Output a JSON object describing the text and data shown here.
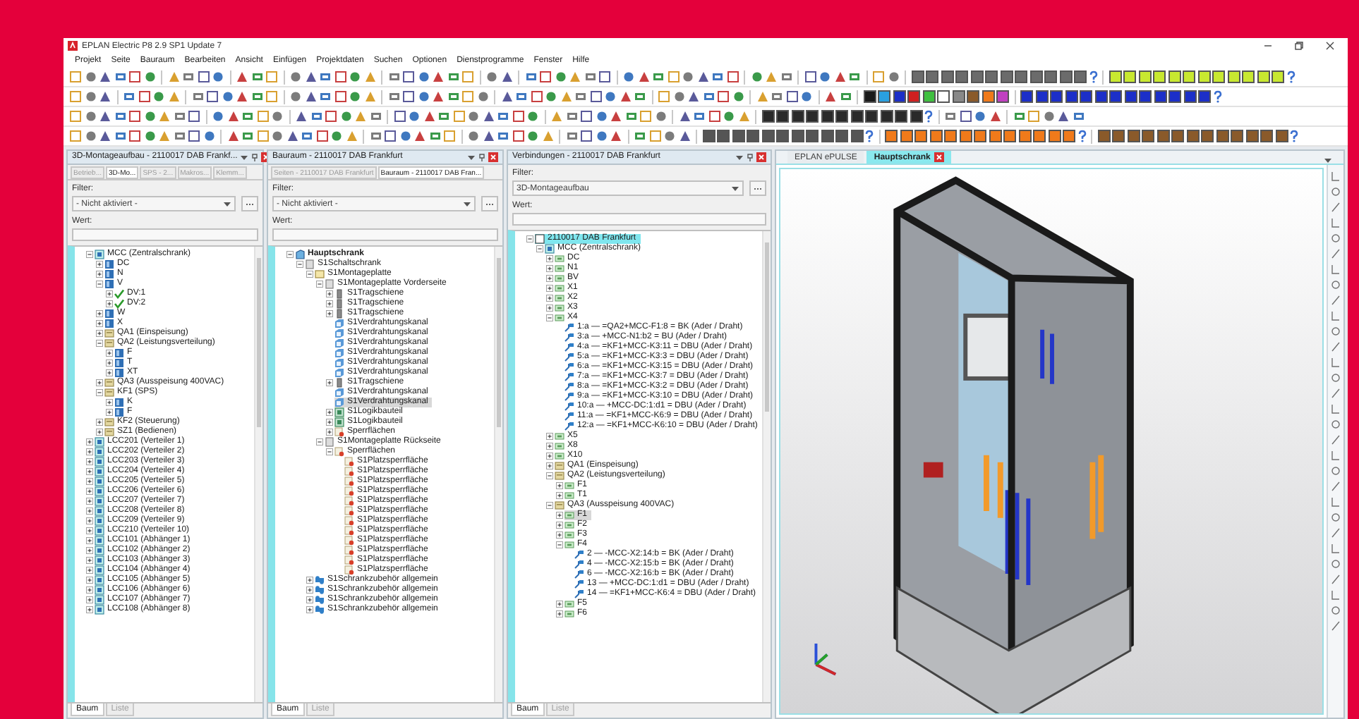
{
  "window": {
    "title": "EPLAN Electric P8 2.9 SP1 Update 7"
  },
  "menu": [
    "Projekt",
    "Seite",
    "Bauraum",
    "Bearbeiten",
    "Ansicht",
    "Einfügen",
    "Projektdaten",
    "Suchen",
    "Optionen",
    "Dienstprogramme",
    "Fenster",
    "Hilfe"
  ],
  "panels": [
    {
      "title": "3D-Montageaufbau - 2110017 DAB Frankf...",
      "tabs": [
        {
          "label": "Betrieb...",
          "selected": false
        },
        {
          "label": "3D-Mo...",
          "selected": true
        },
        {
          "label": "SPS - 2...",
          "selected": false
        },
        {
          "label": "Makros...",
          "selected": false
        },
        {
          "label": "Klemm...",
          "selected": false
        }
      ],
      "filter_label": "Filter:",
      "filter": "- Nicht aktiviert -",
      "value_label": "Wert:",
      "tree": [
        {
          "label": "MCC (Zentralschrank)",
          "kind": "assembly",
          "expanded": true,
          "selected": false,
          "children": [
            {
              "label": "DC",
              "kind": "device",
              "expanded": false,
              "selected": false
            },
            {
              "label": "N",
              "kind": "device",
              "expanded": false,
              "selected": false
            },
            {
              "label": "V",
              "kind": "device",
              "expanded": true,
              "selected": false,
              "children": [
                {
                  "label": "DV:1",
                  "kind": "check",
                  "expanded": false,
                  "selected": false
                },
                {
                  "label": "DV:2",
                  "kind": "check",
                  "expanded": false,
                  "selected": false
                }
              ]
            },
            {
              "label": "W",
              "kind": "device",
              "expanded": false,
              "selected": false
            },
            {
              "label": "X",
              "kind": "device",
              "expanded": false,
              "selected": false
            },
            {
              "label": "QA1 (Einspeisung)",
              "kind": "group",
              "expanded": false,
              "selected": false
            },
            {
              "label": "QA2 (Leistungsverteilung)",
              "kind": "group",
              "expanded": true,
              "selected": false,
              "children": [
                {
                  "label": "F",
                  "kind": "device",
                  "expanded": false,
                  "selected": false
                },
                {
                  "label": "T",
                  "kind": "device",
                  "expanded": false,
                  "selected": false
                },
                {
                  "label": "XT",
                  "kind": "device",
                  "expanded": false,
                  "selected": false
                }
              ]
            },
            {
              "label": "QA3 (Ausspeisung 400VAC)",
              "kind": "group",
              "expanded": false,
              "selected": false
            },
            {
              "label": "KF1 (SPS)",
              "kind": "group",
              "expanded": true,
              "selected": false,
              "children": [
                {
                  "label": "K",
                  "kind": "device",
                  "expanded": false,
                  "selected": false
                },
                {
                  "label": "F",
                  "kind": "device",
                  "expanded": false,
                  "selected": false
                }
              ]
            },
            {
              "label": "KF2 (Steuerung)",
              "kind": "group",
              "expanded": false,
              "selected": false
            },
            {
              "label": "SZ1 (Bedienen)",
              "kind": "group",
              "expanded": false,
              "selected": false
            }
          ]
        },
        {
          "label": "LCC201 (Verteiler 1)",
          "kind": "assembly",
          "expanded": false,
          "selected": false
        },
        {
          "label": "LCC202 (Verteiler 2)",
          "kind": "assembly",
          "expanded": false,
          "selected": false
        },
        {
          "label": "LCC203 (Verteiler 3)",
          "kind": "assembly",
          "expanded": false,
          "selected": false
        },
        {
          "label": "LCC204 (Verteiler 4)",
          "kind": "assembly",
          "expanded": false,
          "selected": false
        },
        {
          "label": "LCC205 (Verteiler 5)",
          "kind": "assembly",
          "expanded": false,
          "selected": false
        },
        {
          "label": "LCC206 (Verteiler 6)",
          "kind": "assembly",
          "expanded": false,
          "selected": false
        },
        {
          "label": "LCC207 (Verteiler 7)",
          "kind": "assembly",
          "expanded": false,
          "selected": false
        },
        {
          "label": "LCC208 (Verteiler 8)",
          "kind": "assembly",
          "expanded": false,
          "selected": false
        },
        {
          "label": "LCC209 (Verteiler 9)",
          "kind": "assembly",
          "expanded": false,
          "selected": false
        },
        {
          "label": "LCC210 (Verteiler 10)",
          "kind": "assembly",
          "expanded": false,
          "selected": false
        },
        {
          "label": "LCC101 (Abhänger 1)",
          "kind": "assembly",
          "expanded": false,
          "selected": false
        },
        {
          "label": "LCC102 (Abhänger 2)",
          "kind": "assembly",
          "expanded": false,
          "selected": false
        },
        {
          "label": "LCC103 (Abhänger 3)",
          "kind": "assembly",
          "expanded": false,
          "selected": false
        },
        {
          "label": "LCC104 (Abhänger 4)",
          "kind": "assembly",
          "expanded": false,
          "selected": false
        },
        {
          "label": "LCC105 (Abhänger 5)",
          "kind": "assembly",
          "expanded": false,
          "selected": false
        },
        {
          "label": "LCC106 (Abhänger 6)",
          "kind": "assembly",
          "expanded": false,
          "selected": false
        },
        {
          "label": "LCC107 (Abhänger 7)",
          "kind": "assembly",
          "expanded": false,
          "selected": false
        },
        {
          "label": "LCC108 (Abhänger 8)",
          "kind": "assembly",
          "expanded": false,
          "selected": false
        }
      ],
      "bottom_tabs": [
        {
          "label": "Baum",
          "selected": true
        },
        {
          "label": "Liste",
          "selected": false
        }
      ]
    },
    {
      "title": "Bauraum - 2110017 DAB Frankfurt",
      "tabs": [
        {
          "label": "Seiten - 2110017 DAB Frankfurt",
          "selected": false
        },
        {
          "label": "Bauraum - 2110017 DAB Fran...",
          "selected": true
        }
      ],
      "filter_label": "Filter:",
      "filter": "- Nicht aktiviert -",
      "value_label": "Wert:",
      "tree": [
        {
          "label": "Hauptschrank",
          "kind": "cabinet",
          "expanded": true,
          "selected": false,
          "children": [
            {
              "label": "S1Schaltschrank",
              "kind": "box",
              "expanded": true,
              "selected": false,
              "children": [
                {
                  "label": "S1Montageplatte",
                  "kind": "plate",
                  "expanded": true,
                  "selected": false,
                  "children": [
                    {
                      "label": "S1Montageplatte Vorderseite",
                      "kind": "box",
                      "expanded": true,
                      "selected": false,
                      "children": [
                        {
                          "label": "S1Tragschiene",
                          "kind": "rail",
                          "expanded": false,
                          "selected": false
                        },
                        {
                          "label": "S1Tragschiene",
                          "kind": "rail",
                          "expanded": false,
                          "selected": false
                        },
                        {
                          "label": "S1Tragschiene",
                          "kind": "rail",
                          "expanded": false,
                          "selected": false
                        },
                        {
                          "label": "S1Verdrahtungskanal",
                          "kind": "duct",
                          "selected": false
                        },
                        {
                          "label": "S1Verdrahtungskanal",
                          "kind": "duct",
                          "selected": false
                        },
                        {
                          "label": "S1Verdrahtungskanal",
                          "kind": "duct",
                          "selected": false
                        },
                        {
                          "label": "S1Verdrahtungskanal",
                          "kind": "duct",
                          "selected": false
                        },
                        {
                          "label": "S1Verdrahtungskanal",
                          "kind": "duct",
                          "selected": false
                        },
                        {
                          "label": "S1Verdrahtungskanal",
                          "kind": "duct",
                          "selected": false
                        },
                        {
                          "label": "S1Tragschiene",
                          "kind": "rail",
                          "expanded": false,
                          "selected": false
                        },
                        {
                          "label": "S1Verdrahtungskanal",
                          "kind": "duct",
                          "selected": false
                        },
                        {
                          "label": "S1Verdrahtungskanal",
                          "kind": "duct",
                          "selected": true
                        },
                        {
                          "label": "S1Logikbauteil",
                          "kind": "logic",
                          "expanded": false,
                          "selected": false
                        },
                        {
                          "label": "S1Logikbauteil",
                          "kind": "logic",
                          "expanded": false,
                          "selected": false
                        },
                        {
                          "label": "Sperrflächen",
                          "kind": "blocked",
                          "expanded": false,
                          "selected": false
                        }
                      ]
                    },
                    {
                      "label": "S1Montageplatte Rückseite",
                      "kind": "box",
                      "expanded": true,
                      "selected": false,
                      "children": [
                        {
                          "label": "Sperrflächen",
                          "kind": "blocked",
                          "expanded": true,
                          "selected": false,
                          "children": [
                            {
                              "label": "S1Platzsperrfläche",
                              "kind": "blocked",
                              "selected": false
                            },
                            {
                              "label": "S1Platzsperrfläche",
                              "kind": "blocked",
                              "selected": false
                            },
                            {
                              "label": "S1Platzsperrfläche",
                              "kind": "blocked",
                              "selected": false
                            },
                            {
                              "label": "S1Platzsperrfläche",
                              "kind": "blocked",
                              "selected": false
                            },
                            {
                              "label": "S1Platzsperrfläche",
                              "kind": "blocked",
                              "selected": false
                            },
                            {
                              "label": "S1Platzsperrfläche",
                              "kind": "blocked",
                              "selected": false
                            },
                            {
                              "label": "S1Platzsperrfläche",
                              "kind": "blocked",
                              "selected": false
                            },
                            {
                              "label": "S1Platzsperrfläche",
                              "kind": "blocked",
                              "selected": false
                            },
                            {
                              "label": "S1Platzsperrfläche",
                              "kind": "blocked",
                              "selected": false
                            },
                            {
                              "label": "S1Platzsperrfläche",
                              "kind": "blocked",
                              "selected": false
                            },
                            {
                              "label": "S1Platzsperrfläche",
                              "kind": "blocked",
                              "selected": false
                            },
                            {
                              "label": "S1Platzsperrfläche",
                              "kind": "blocked",
                              "selected": false
                            }
                          ]
                        }
                      ]
                    }
                  ]
                },
                {
                  "label": "S1Schrankzubehör allgemein",
                  "kind": "accessory",
                  "expanded": false,
                  "selected": false
                },
                {
                  "label": "S1Schrankzubehör allgemein",
                  "kind": "accessory",
                  "expanded": false,
                  "selected": false
                },
                {
                  "label": "S1Schrankzubehör allgemein",
                  "kind": "accessory",
                  "expanded": false,
                  "selected": false
                },
                {
                  "label": "S1Schrankzubehör allgemein",
                  "kind": "accessory",
                  "expanded": false,
                  "selected": false
                }
              ]
            }
          ]
        }
      ],
      "bottom_tabs": [
        {
          "label": "Baum",
          "selected": true
        },
        {
          "label": "Liste",
          "selected": false
        }
      ]
    },
    {
      "title": "Verbindungen - 2110017 DAB Frankfurt",
      "filter_label": "Filter:",
      "filter": "3D-Montageaufbau",
      "value_label": "Wert:",
      "tree": [
        {
          "label": "2110017 DAB Frankfurt",
          "kind": "project",
          "expanded": true,
          "selected": true,
          "children": [
            {
              "label": "MCC (Zentralschrank)",
              "kind": "assembly",
              "expanded": true,
              "selected": false,
              "children": [
                {
                  "label": "DC",
                  "kind": "terminal",
                  "expanded": false,
                  "selected": false
                },
                {
                  "label": "N1",
                  "kind": "terminal",
                  "expanded": false,
                  "selected": false
                },
                {
                  "label": "BV",
                  "kind": "terminal",
                  "expanded": false,
                  "selected": false
                },
                {
                  "label": "X1",
                  "kind": "terminal",
                  "expanded": false,
                  "selected": false
                },
                {
                  "label": "X2",
                  "kind": "terminal",
                  "expanded": false,
                  "selected": false
                },
                {
                  "label": "X3",
                  "kind": "terminal",
                  "expanded": false,
                  "selected": false
                },
                {
                  "label": "X4",
                  "kind": "terminal",
                  "expanded": true,
                  "selected": false,
                  "children": [
                    {
                      "label": "1:a — =QA2+MCC-F1:8 = BK (Ader / Draht)",
                      "kind": "connection",
                      "selected": false
                    },
                    {
                      "label": "3:a — +MCC-N1:b2 = BU (Ader / Draht)",
                      "kind": "connection",
                      "selected": false
                    },
                    {
                      "label": "4:a — =KF1+MCC-K3:11 = DBU (Ader / Draht)",
                      "kind": "connection",
                      "selected": false
                    },
                    {
                      "label": "5:a — =KF1+MCC-K3:3 = DBU (Ader / Draht)",
                      "kind": "connection",
                      "selected": false
                    },
                    {
                      "label": "6:a — =KF1+MCC-K3:15 = DBU (Ader / Draht)",
                      "kind": "connection",
                      "selected": false
                    },
                    {
                      "label": "7:a — =KF1+MCC-K3:7 = DBU (Ader / Draht)",
                      "kind": "connection",
                      "selected": false
                    },
                    {
                      "label": "8:a — =KF1+MCC-K3:2 = DBU (Ader / Draht)",
                      "kind": "connection",
                      "selected": false
                    },
                    {
                      "label": "9:a — =KF1+MCC-K3:10 = DBU (Ader / Draht)",
                      "kind": "connection",
                      "selected": false
                    },
                    {
                      "label": "10:a — +MCC-DC:1:d1 = DBU (Ader / Draht)",
                      "kind": "connection",
                      "selected": false
                    },
                    {
                      "label": "11:a — =KF1+MCC-K6:9 = DBU (Ader / Draht)",
                      "kind": "connection",
                      "selected": false
                    },
                    {
                      "label": "12:a — =KF1+MCC-K6:10 = DBU (Ader / Draht)",
                      "kind": "connection",
                      "selected": false
                    }
                  ]
                },
                {
                  "label": "X5",
                  "kind": "terminal",
                  "expanded": false,
                  "selected": false
                },
                {
                  "label": "X8",
                  "kind": "terminal",
                  "expanded": false,
                  "selected": false
                },
                {
                  "label": "X10",
                  "kind": "terminal",
                  "expanded": false,
                  "selected": false
                },
                {
                  "label": "QA1 (Einspeisung)",
                  "kind": "group",
                  "expanded": false,
                  "selected": false
                },
                {
                  "label": "QA2 (Leistungsverteilung)",
                  "kind": "group",
                  "expanded": true,
                  "selected": false,
                  "children": [
                    {
                      "label": "F1",
                      "kind": "terminal",
                      "expanded": false,
                      "selected": false
                    },
                    {
                      "label": "T1",
                      "kind": "terminal",
                      "expanded": false,
                      "selected": false
                    }
                  ]
                },
                {
                  "label": "QA3 (Ausspeisung 400VAC)",
                  "kind": "group",
                  "expanded": true,
                  "selected": false,
                  "children": [
                    {
                      "label": "F1",
                      "kind": "terminal",
                      "expanded": false,
                      "selected": true
                    },
                    {
                      "label": "F2",
                      "kind": "terminal",
                      "expanded": false,
                      "selected": false
                    },
                    {
                      "label": "F3",
                      "kind": "terminal",
                      "expanded": false,
                      "selected": false
                    },
                    {
                      "label": "F4",
                      "kind": "terminal",
                      "expanded": true,
                      "selected": false,
                      "children": [
                        {
                          "label": "2 — -MCC-X2:14:b = BK (Ader / Draht)",
                          "kind": "connection",
                          "selected": false
                        },
                        {
                          "label": "4 — -MCC-X2:15:b = BK (Ader / Draht)",
                          "kind": "connection",
                          "selected": false
                        },
                        {
                          "label": "6 — -MCC-X2:16:b = BK (Ader / Draht)",
                          "kind": "connection",
                          "selected": false
                        },
                        {
                          "label": "13 — +MCC-DC:1:d1 = DBU (Ader / Draht)",
                          "kind": "connection",
                          "selected": false
                        },
                        {
                          "label": "14 — =KF1+MCC-K6:4 = DBU (Ader / Draht)",
                          "kind": "connection",
                          "selected": false
                        }
                      ]
                    },
                    {
                      "label": "F5",
                      "kind": "terminal",
                      "expanded": false,
                      "selected": false
                    },
                    {
                      "label": "F6",
                      "kind": "terminal",
                      "expanded": false,
                      "selected": false
                    }
                  ]
                }
              ]
            }
          ]
        }
      ],
      "bottom_tabs": [
        {
          "label": "Baum",
          "selected": true
        },
        {
          "label": "Liste",
          "selected": false
        }
      ]
    }
  ],
  "viewer": {
    "tabs": [
      {
        "label": "EPLAN ePULSE",
        "selected": false
      },
      {
        "label": "Hauptschrank",
        "selected": true
      }
    ]
  }
}
